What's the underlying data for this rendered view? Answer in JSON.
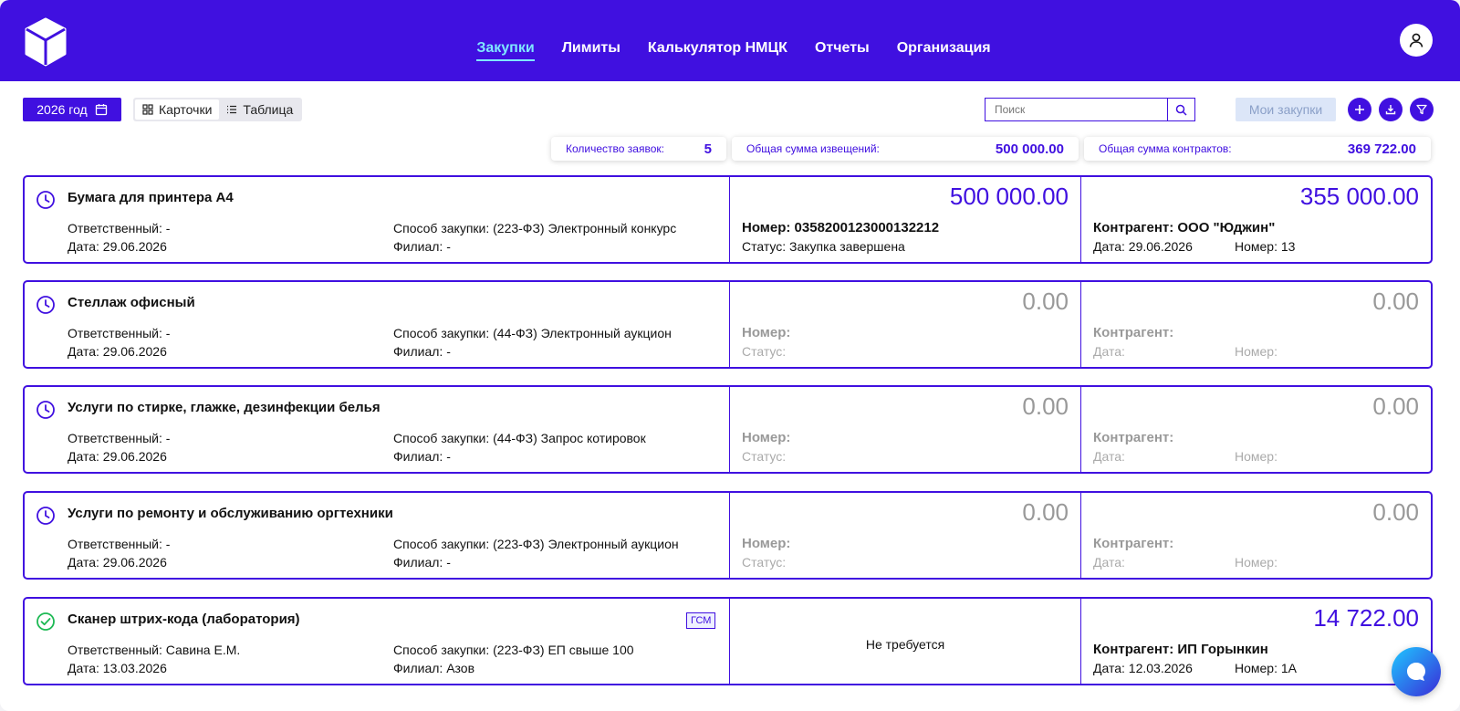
{
  "nav": {
    "items": [
      "Закупки",
      "Лимиты",
      "Калькулятор НМЦК",
      "Отчеты",
      "Организация"
    ]
  },
  "toolbar": {
    "year_label": "2026 год",
    "view_cards": "Карточки",
    "view_table": "Таблица",
    "search_placeholder": "Поиск",
    "my_purchases": "Мои закупки"
  },
  "stats": {
    "count_label": "Количество заявок:",
    "count_value": "5",
    "notices_label": "Общая сумма извещений:",
    "notices_value": "500 000.00",
    "contracts_label": "Общая сумма контрактов:",
    "contracts_value": "369 722.00"
  },
  "cards": [
    {
      "status": "clock-icon",
      "title": "Бумага для принтера А4",
      "responsible": "Ответственный: -",
      "date": "Дата: 29.06.2026",
      "method": "Способ закупки: (223-ФЗ) Электронный конкурс",
      "branch": "Филиал: -",
      "notice_amount": "500 000.00",
      "notice_number": "Номер: 0358200123000132212",
      "notice_status": "Статус: Закупка завершена",
      "contract_amount": "355 000.00",
      "contractor": "Контрагент: ООО \"Юджин\"",
      "contract_date": "Дата: 29.06.2026",
      "contract_no": "Номер: 13"
    },
    {
      "status": "clock-icon",
      "title": "Стеллаж офисный",
      "responsible": "Ответственный: -",
      "date": "Дата: 29.06.2026",
      "method": "Способ закупки: (44-ФЗ) Электронный аукцион",
      "branch": "Филиал: -",
      "notice_amount": "0.00",
      "notice_number": "Номер:",
      "notice_status": "Статус:",
      "contract_amount": "0.00",
      "contractor": "Контрагент:",
      "contract_date": "Дата:",
      "contract_no": "Номер:"
    },
    {
      "status": "clock-icon",
      "title": "Услуги по стирке, глажке, дезинфекции белья",
      "responsible": "Ответственный: -",
      "date": "Дата: 29.06.2026",
      "method": "Способ закупки: (44-ФЗ) Запрос котировок",
      "branch": "Филиал: -",
      "notice_amount": "0.00",
      "notice_number": "Номер:",
      "notice_status": "Статус:",
      "contract_amount": "0.00",
      "contractor": "Контрагент:",
      "contract_date": "Дата:",
      "contract_no": "Номер:"
    },
    {
      "status": "clock-icon",
      "title": "Услуги по ремонту и обслуживанию оргтехники",
      "responsible": "Ответственный: -",
      "date": "Дата: 29.06.2026",
      "method": "Способ закупки: (223-ФЗ) Электронный аукцион",
      "branch": "Филиал: -",
      "notice_amount": "0.00",
      "notice_number": "Номер:",
      "notice_status": "Статус:",
      "contract_amount": "0.00",
      "contractor": "Контрагент:",
      "contract_date": "Дата:",
      "contract_no": "Номер:"
    },
    {
      "status": "check-circle-icon",
      "title": "Сканер штрих-кода (лаборатория)",
      "tag": "ГСМ",
      "responsible": "Ответственный: Савина Е.М.",
      "date": "Дата: 13.03.2026",
      "method": "Способ закупки: (223-ФЗ) ЕП свыше 100",
      "branch": "Филиал: Азов",
      "notice_text": "Не требуется",
      "contract_amount": "14 722.00",
      "contractor": "Контрагент: ИП Горынкин",
      "contract_date": "Дата: 12.03.2026",
      "contract_no": "Номер: 1А"
    }
  ],
  "colors": {
    "accent": "#4010e0",
    "active_nav": "#7fe7ff",
    "muted": "#999999",
    "success": "#1db954"
  }
}
